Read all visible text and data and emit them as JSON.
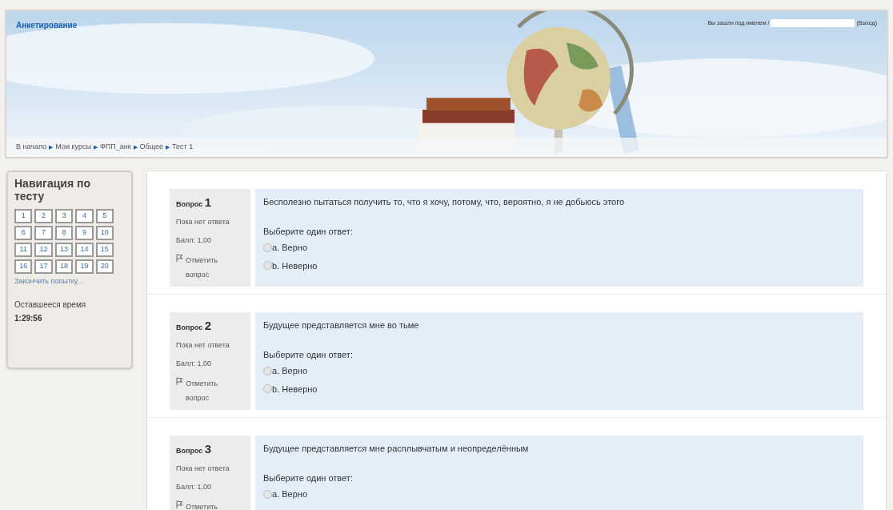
{
  "header": {
    "site_title": "Анкетирование",
    "login_prefix": "Вы зашли под именем /",
    "logout": "(Выход)",
    "breadcrumb": [
      {
        "kind": "link",
        "text": "В начало"
      },
      {
        "kind": "sep",
        "text": "▶"
      },
      {
        "kind": "link",
        "text": "Мои курсы"
      },
      {
        "kind": "sep",
        "text": "▶"
      },
      {
        "kind": "link",
        "text": "ФПП_анк"
      },
      {
        "kind": "sep",
        "text": "▶"
      },
      {
        "kind": "link",
        "text": "Общее"
      },
      {
        "kind": "sep",
        "text": "▶"
      },
      {
        "kind": "link",
        "text": "Тест 1"
      }
    ]
  },
  "sidebar": {
    "title": "Навигация по тесту",
    "questions": [
      "1",
      "2",
      "3",
      "4",
      "5",
      "6",
      "7",
      "8",
      "9",
      "10",
      "11",
      "12",
      "13",
      "14",
      "15",
      "16",
      "17",
      "18",
      "19",
      "20"
    ],
    "finish_link": "Закончить попытку...",
    "timer_label": "Оставшееся время",
    "timer_value": "1:29:56"
  },
  "questions": [
    {
      "label": "Вопрос",
      "number": "1",
      "status": "Пока нет ответа",
      "score": "Балл: 1,00",
      "flag": "Отметить вопрос",
      "text": "Бесполезно пытаться получить то, что я хочу, потому, что, вероятно, я не добьюсь этого",
      "prompt": "Выберите один ответ:",
      "options": [
        {
          "text": "a. Верно",
          "selected": false
        },
        {
          "text": "b. Неверно",
          "selected": false
        }
      ]
    },
    {
      "label": "Вопрос",
      "number": "2",
      "status": "Пока нет ответа",
      "score": "Балл: 1,00",
      "flag": "Отметить вопрос",
      "text": "Будущее представляется мне во тьме",
      "prompt": "Выберите один ответ:",
      "options": [
        {
          "text": "a. Верно",
          "selected": false
        },
        {
          "text": "b. Неверно",
          "selected": false
        }
      ]
    },
    {
      "label": "Вопрос",
      "number": "3",
      "status": "Пока нет ответа",
      "score": "Балл: 1,00",
      "flag": "Отметить",
      "text": "Будущее представляется мне расплывчатым и неопределённым",
      "prompt": "Выберите один ответ:",
      "options": [
        {
          "text": "a. Верно",
          "selected": false
        }
      ]
    }
  ]
}
